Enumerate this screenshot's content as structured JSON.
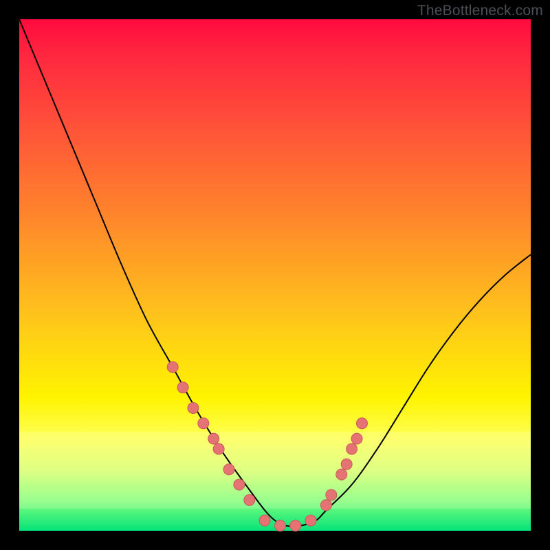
{
  "attribution": "TheBottleneck.com",
  "colors": {
    "frame": "#000000",
    "curve": "#000000",
    "marker_fill": "#e57373",
    "marker_stroke": "#c75a5a"
  },
  "chart_data": {
    "type": "line",
    "title": "",
    "xlabel": "",
    "ylabel": "",
    "xlim": [
      0,
      100
    ],
    "ylim": [
      0,
      100
    ],
    "grid": false,
    "series": [
      {
        "name": "bottleneck-curve",
        "x": [
          0,
          5,
          10,
          15,
          20,
          25,
          30,
          35,
          40,
          45,
          48,
          50,
          52,
          55,
          58,
          60,
          65,
          70,
          75,
          80,
          85,
          90,
          95,
          100
        ],
        "y": [
          100,
          88,
          76,
          64,
          52,
          41,
          32,
          23,
          15,
          8,
          4,
          2,
          1,
          1,
          2,
          4,
          9,
          16,
          24,
          32,
          39,
          45,
          50,
          54
        ]
      }
    ],
    "markers": {
      "name": "data-points",
      "x": [
        30,
        32,
        34,
        36,
        38,
        39,
        41,
        43,
        45,
        48,
        51,
        54,
        57,
        60,
        61,
        63,
        64,
        65,
        66,
        67
      ],
      "y": [
        32,
        28,
        24,
        21,
        18,
        16,
        12,
        9,
        6,
        2,
        1,
        1,
        2,
        5,
        7,
        11,
        13,
        16,
        18,
        21
      ]
    }
  }
}
